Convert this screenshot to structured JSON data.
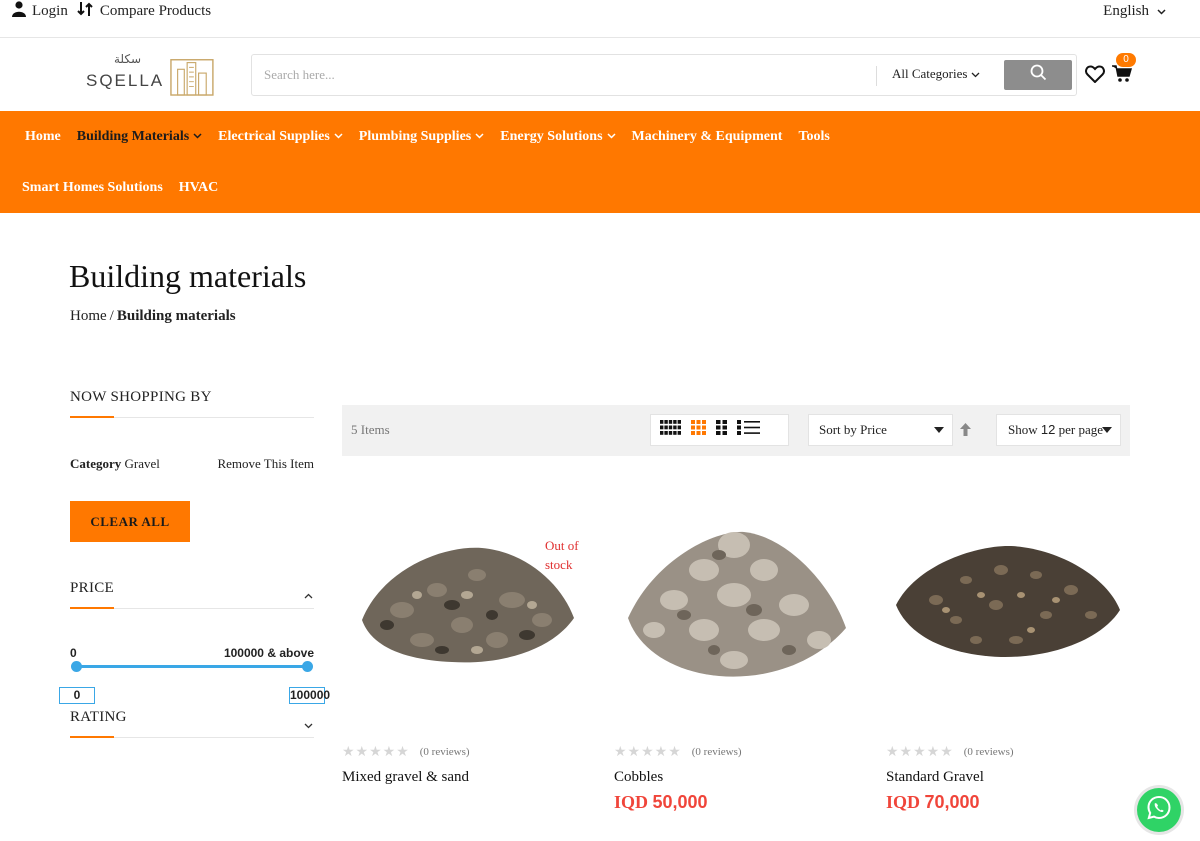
{
  "topbar": {
    "login_label": "Login",
    "compare_label": "Compare Products",
    "language": "English",
    "icons": [
      "user-icon",
      "compare-icon",
      "chevron-down-icon"
    ]
  },
  "header": {
    "logo_text": "SQELLA",
    "logo_arabic": "سكلة",
    "search_placeholder": "Search here...",
    "category_select": "All Categories",
    "cart_count": "0",
    "accent_color": "#ff7800"
  },
  "nav": {
    "items": [
      {
        "label": "Home",
        "dropdown": false,
        "active": false
      },
      {
        "label": "Building Materials",
        "dropdown": true,
        "active": true
      },
      {
        "label": "Electrical Supplies",
        "dropdown": true,
        "active": false
      },
      {
        "label": "Plumbing Supplies",
        "dropdown": true,
        "active": false
      },
      {
        "label": "Energy Solutions",
        "dropdown": true,
        "active": false
      },
      {
        "label": "Machinery & Equipment",
        "dropdown": false,
        "active": false
      },
      {
        "label": "Tools",
        "dropdown": false,
        "active": false
      },
      {
        "label": "Smart Homes Solutions",
        "dropdown": false,
        "active": false
      },
      {
        "label": "HVAC",
        "dropdown": false,
        "active": false
      }
    ]
  },
  "page": {
    "title": "Building materials",
    "breadcrumb_home": "Home",
    "breadcrumb_sep": "/",
    "breadcrumb_current": "Building materials"
  },
  "sidebar": {
    "now_shopping_title": "NOW SHOPPING BY",
    "filter_label": "Category",
    "filter_value": "Gravel",
    "remove_label": "Remove This Item",
    "clear_all": "CLEAR ALL",
    "price_title": "PRICE",
    "price_min_label": "0",
    "price_max_label": "100000 & above",
    "price_min_value": "0",
    "price_max_value": "100000",
    "rating_title": "RATING"
  },
  "toolbar": {
    "items_count": "5 Items",
    "sort_label": "Sort by Price",
    "show_prefix": "Show",
    "show_value": "12",
    "show_suffix": "per page",
    "active_view": "grid-4"
  },
  "products": [
    {
      "name": "Mixed gravel & sand",
      "reviews": "(0  reviews)",
      "stock": "Out of stock",
      "price_currency": "",
      "price_value": "",
      "rating": 0
    },
    {
      "name": "Cobbles",
      "reviews": "(0  reviews)",
      "stock": "",
      "price_currency": "IQD",
      "price_value": "50,000",
      "rating": 0
    },
    {
      "name": "Standard Gravel",
      "reviews": "(0  reviews)",
      "stock": "",
      "price_currency": "IQD",
      "price_value": "70,000",
      "rating": 0
    }
  ]
}
